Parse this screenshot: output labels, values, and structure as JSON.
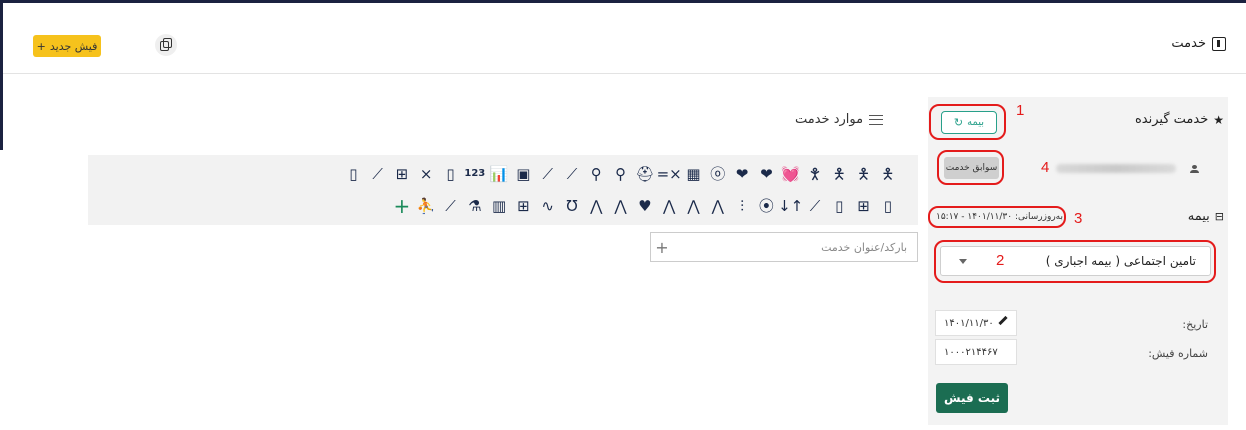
{
  "header": {
    "title": "خدمت",
    "title_icon": "receipt-icon",
    "new_receipt_label": "فیش جدید",
    "new_receipt_plus": "+",
    "copy_icon": "copy-icon"
  },
  "services": {
    "title": "موارد خدمت",
    "search_placeholder": "بارکد/عنوان خدمت",
    "search_plus": "+",
    "row1_icons": [
      "🯅",
      "🯅",
      "🯅",
      "🯆",
      "💓",
      "❤",
      "❤",
      "ⓞ",
      "▦",
      "=×",
      "⛑",
      "⚲",
      "⚲",
      "⟋",
      "⟋",
      "▣",
      "📊",
      "123",
      "▯",
      "×",
      "⊞",
      "⟋",
      "▯"
    ],
    "row2_icons": [
      "▯",
      "⊞",
      "▯",
      "⟋",
      "↓↑",
      "⦿",
      "⫶",
      "⋀",
      "⋀",
      "⋀",
      "♥",
      "⋀",
      "⋀",
      "Ʊ",
      "∿",
      "⊞",
      "▥",
      "⚗",
      "⟋",
      "⛹",
      "+"
    ]
  },
  "receiver": {
    "title": "خدمت گیرنده",
    "star_icon": "star-icon",
    "insurance_button": "بیمه",
    "history_button": "سوابق خدمت"
  },
  "insurance": {
    "title": "بیمه",
    "updated_text": "به‌روزرسانی: ۱۴۰۱/۱۱/۳۰ - ۱۵:۱۷",
    "selected_value": "تامین اجتماعی ( بیمه اجباری )"
  },
  "receipt": {
    "date_label": "تاریخ:",
    "date_value": "۱۴۰۱/۱۱/۳۰",
    "number_label": "شماره فیش:",
    "number_value": "۱۰۰۰۲۱۴۴۶۷",
    "submit_label": "ثبت فیش"
  },
  "annotations": {
    "n1": "1",
    "n2": "2",
    "n3": "3",
    "n4": "4",
    "color": "#e41b1b"
  },
  "colors": {
    "accent_yellow": "#f6c21c",
    "primary_green": "#1b6d52",
    "teal": "#28a08a"
  }
}
